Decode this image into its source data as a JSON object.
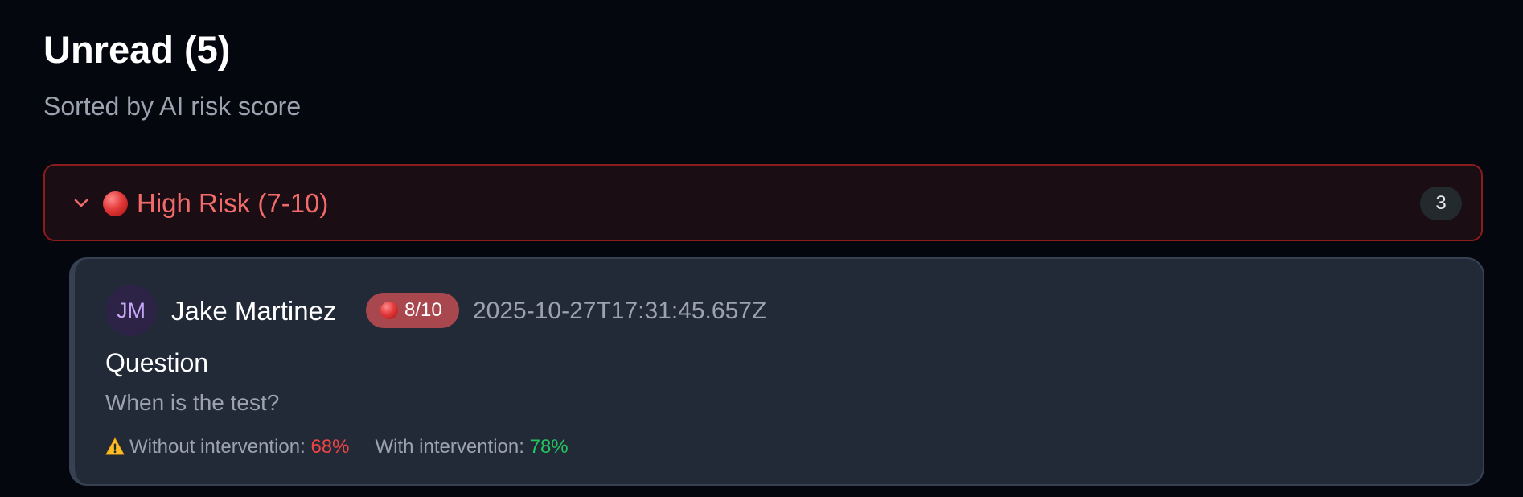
{
  "header": {
    "title": "Unread (5)",
    "subtitle": "Sorted by AI risk score"
  },
  "group": {
    "label": "High Risk (7-10)",
    "count": "3",
    "expanded": true,
    "icon": "chevron-down-icon",
    "dot_icon": "red-circle-icon",
    "border_color": "#8b1c1c",
    "label_color": "#f26b6b"
  },
  "message": {
    "avatar_initials": "JM",
    "sender": "Jake Martinez",
    "risk_score": "8/10",
    "timestamp": "2025-10-27T17:31:45.657Z",
    "type": "Question",
    "body": "When is the test?",
    "without_label": "Without intervention:",
    "without_value": "68%",
    "with_label": "With intervention:",
    "with_value": "78%",
    "warning_icon": "warning-icon",
    "colors": {
      "bad": "#ef4444",
      "good": "#22c55e",
      "risk_badge": "#a8474d"
    }
  }
}
